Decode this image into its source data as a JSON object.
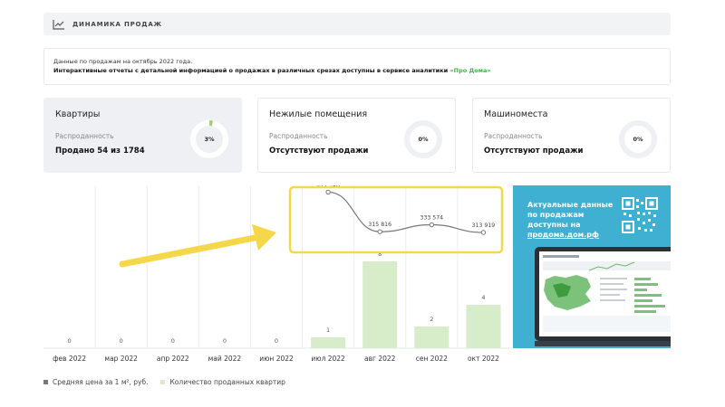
{
  "header": {
    "title": "ДИНАМИКА ПРОДАЖ",
    "icon": "trend-chart-icon"
  },
  "info": {
    "line1": "Данные по продажам на октябрь 2022 года.",
    "line2_prefix": "Интерактивные отчеты с детальной информацией о продажах в различных срезах доступны в сервисе аналитики ",
    "line2_link": "«Про Дома»"
  },
  "cards": [
    {
      "title": "Квартиры",
      "sub": "Распроданность",
      "value": "Продано 54 из 1784",
      "percent_label": "3%",
      "percent": 3
    },
    {
      "title": "Нежилые помещения",
      "sub": "Распроданность",
      "value": "Отсутствуют продажи",
      "percent_label": "0%",
      "percent": 0
    },
    {
      "title": "Машиноместа",
      "sub": "Распроданность",
      "value": "Отсутствуют продажи",
      "percent_label": "0%",
      "percent": 0
    }
  ],
  "chart_data": {
    "type": "bar",
    "categories": [
      "фев 2022",
      "мар 2022",
      "апр 2022",
      "май 2022",
      "июн 2022",
      "июл 2022",
      "авг 2022",
      "сен 2022",
      "окт 2022"
    ],
    "series": [
      {
        "name": "Количество проданных квартир",
        "type": "bar",
        "values": [
          0,
          0,
          0,
          0,
          0,
          1,
          8,
          2,
          4
        ],
        "labels": [
          "0",
          "0",
          "0",
          "0",
          "0",
          "1",
          "8",
          "2",
          "4"
        ]
      },
      {
        "name": "Средняя цена за 1 м², руб.",
        "type": "line",
        "values": [
          null,
          null,
          null,
          null,
          null,
          417380,
          315816,
          333574,
          313919
        ],
        "labels": [
          "",
          "",
          "",
          "",
          "",
          "417 380",
          "315 816",
          "333 574",
          "313 919"
        ]
      }
    ],
    "ylim_bar": [
      0,
      10
    ],
    "ylim_line": [
      300000,
      430000
    ],
    "grid": true
  },
  "legend": [
    {
      "label": "Средняя цена за 1 м², руб.",
      "color": "#777777"
    },
    {
      "label": "Количество проданных квартир",
      "color": "#d7ecc9"
    }
  ],
  "promo": {
    "text_prefix": "Актуальные данные по продажам доступны на ",
    "link": "продома.дом.рф",
    "background": "#3fb0d2"
  },
  "colors": {
    "accent_green": "#3ab54a",
    "bar": "#d7ecc9",
    "line": "#777777",
    "highlight": "#f5d84a"
  }
}
